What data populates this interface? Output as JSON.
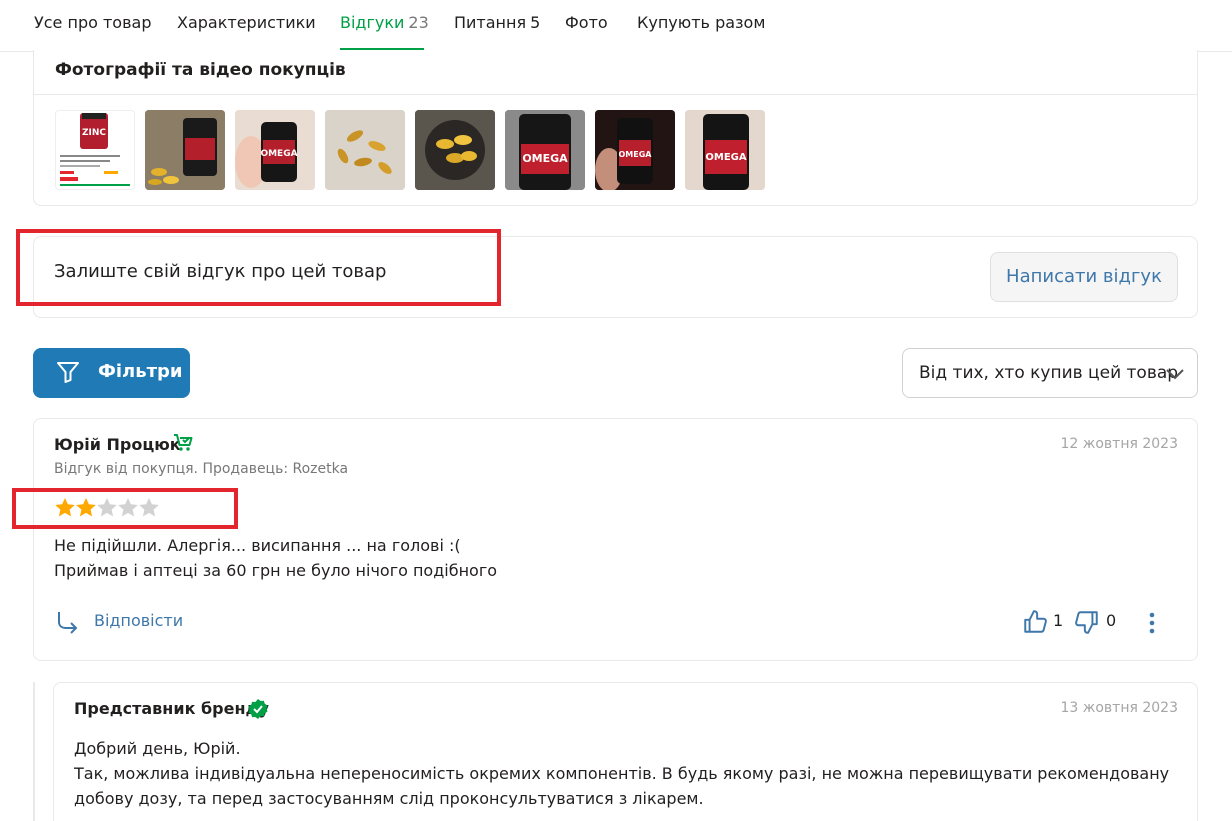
{
  "tabs": [
    {
      "label": "Усе про товар",
      "count": ""
    },
    {
      "label": "Характеристики",
      "count": ""
    },
    {
      "label": "Відгуки",
      "count": "23"
    },
    {
      "label": "Питання",
      "count": "5"
    },
    {
      "label": "Фото",
      "count": ""
    },
    {
      "label": "Купують разом",
      "count": ""
    }
  ],
  "active_tab": "Відгуки",
  "photos": {
    "title": "Фотографії та відео покупців",
    "thumbnails": [
      {
        "label": "ZINC"
      },
      {
        "label": ""
      },
      {
        "label": "OMEGA"
      },
      {
        "label": ""
      },
      {
        "label": ""
      },
      {
        "label": "OMEGA"
      },
      {
        "label": "OMEGA"
      },
      {
        "label": "OMEGA"
      }
    ]
  },
  "leave_review": {
    "prompt": "Залиште свій відгук про цей товар",
    "button_label": "Написати відгук"
  },
  "filters": {
    "button_label": "Фільтри",
    "sort_selected": "Від тих, хто купив цей товар"
  },
  "review": {
    "author": "Юрій Процюк",
    "date": "12 жовтня 2023",
    "meta": "Відгук від покупця. Продавець: Rozetka",
    "rating": 2,
    "rating_max": 5,
    "text_lines": [
      "Не підійшли. Алергія... висипання ... на голові :(",
      "Приймав і аптеці за 60 грн не було нічого подібного"
    ],
    "reply_label": "Відповісти",
    "likes": "1",
    "dislikes": "0"
  },
  "brand_reply": {
    "author": "Представник бренду",
    "date": "13 жовтня 2023",
    "text_lines": [
      "Добрий день, Юрій.",
      "Так, можлива індивідуальна непереносимість окремих компонентів. В будь якому разі, не можна перевищувати рекомендовану добову дозу, та перед застосуванням слід проконсультуватися з лікарем."
    ]
  },
  "colors": {
    "accent_green": "#00a046",
    "link_blue": "#3e77aa",
    "filter_blue": "#1f7ab5",
    "star_filled": "#ffa900",
    "star_empty": "#d2d2d2",
    "highlight_red": "#e3262d"
  },
  "icons": {
    "filter": "filter-funnel-icon",
    "sort": "chevron-down-icon",
    "buyer": "verified-buyer-cart-icon",
    "brand": "verified-badge-icon",
    "reply": "reply-arrow-icon",
    "like": "thumbs-up-icon",
    "dislike": "thumbs-down-icon",
    "more": "more-vertical-icon"
  }
}
